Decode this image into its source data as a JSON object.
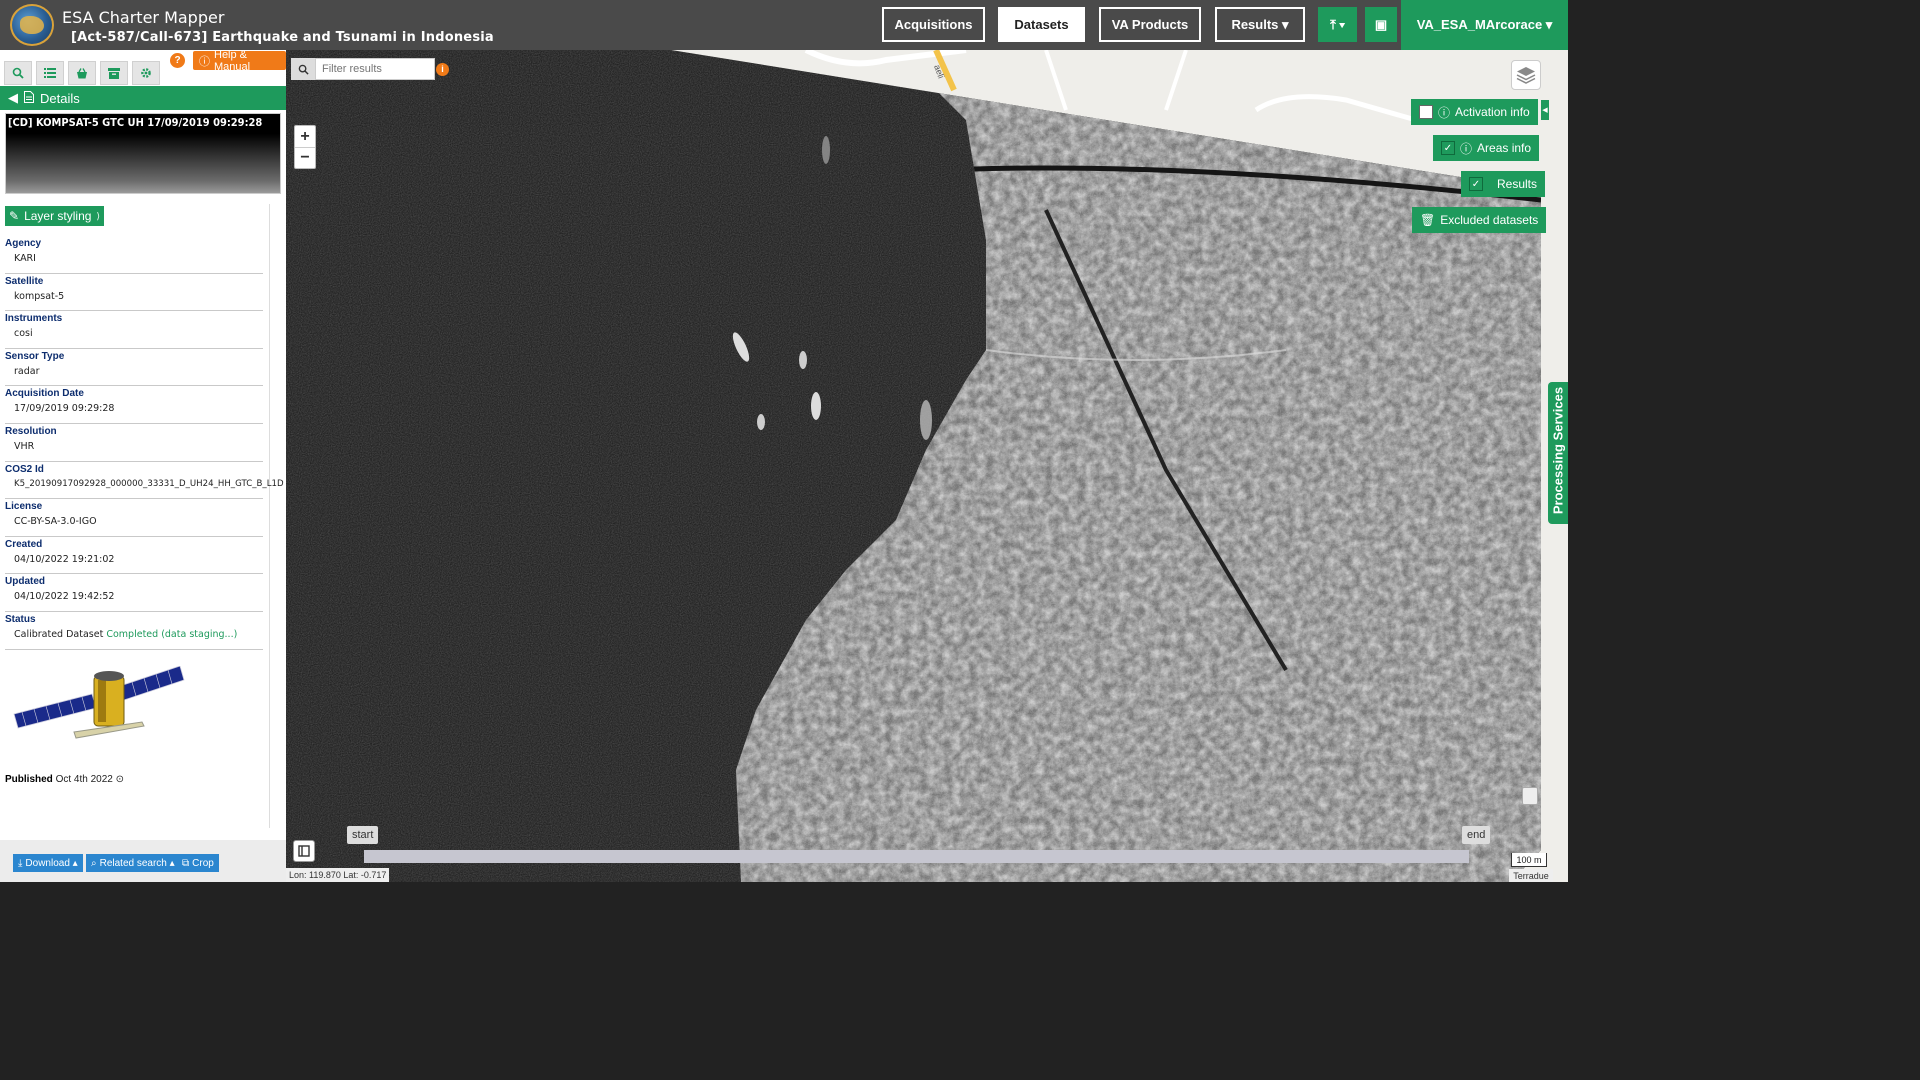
{
  "header": {
    "app_title": "ESA Charter Mapper",
    "subtitle": "[Act-587/Call-673] Earthquake and Tsunami in Indonesia",
    "nav": [
      {
        "label": "Acquisitions",
        "active": false
      },
      {
        "label": "Datasets",
        "active": true
      },
      {
        "label": "VA Products",
        "active": false
      },
      {
        "label": "Results ▾",
        "active": false
      }
    ],
    "upload_label": "⤒ ▾",
    "briefcase_label": "▣",
    "user": "VA_ESA_MArcorace ▾"
  },
  "sidebar": {
    "help_label": "Help & Manual",
    "question_label": "?",
    "details_label": "Details",
    "preview_title": "[CD] KOMPSAT-5 GTC UH 17/09/2019 09:29:28",
    "layer_styling_label": "Layer styling",
    "metadata": [
      {
        "label": "Agency",
        "value": "KARI"
      },
      {
        "label": "Satellite",
        "value": "kompsat-5"
      },
      {
        "label": "Instruments",
        "value": "cosi"
      },
      {
        "label": "Sensor Type",
        "value": "radar"
      },
      {
        "label": "Acquisition Date",
        "value": "17/09/2019 09:29:28"
      },
      {
        "label": "Resolution",
        "value": "VHR"
      },
      {
        "label": "COS2 Id",
        "value": "K5_20190917092928_000000_33331_D_UH24_HH_GTC_B_L1D"
      },
      {
        "label": "License",
        "value": "CC-BY-SA-3.0-IGO"
      },
      {
        "label": "Created",
        "value": "04/10/2022 19:21:02"
      },
      {
        "label": "Updated",
        "value": "04/10/2022 19:42:52"
      }
    ],
    "status": {
      "label": "Status",
      "prefix": "Calibrated Dataset",
      "state": "Completed (data staging...)"
    },
    "published_label": "Published",
    "published_value": "Oct 4th 2022 ⊙",
    "buttons": {
      "download": "Download ▴",
      "related": "Related search ▴",
      "crop": "Crop"
    }
  },
  "map": {
    "filter_placeholder": "Filter results",
    "zoom_in": "+",
    "zoom_out": "−",
    "activation_info": "Activation info",
    "areas_info": "Areas info",
    "results": "Results",
    "excluded": "Excluded datasets",
    "processing_services": "Processing Services",
    "timeline_start": "start",
    "timeline_end": "end",
    "coords": "Lon: 119.870 Lat: -0.717",
    "scale": "100 m",
    "attribution": "Terradue",
    "road_label": "aeli"
  },
  "colors": {
    "accent_green": "#1e9a5c",
    "header_bg": "#4a4a4a",
    "help_orange": "#f07a18",
    "button_blue": "#2b86cf"
  }
}
